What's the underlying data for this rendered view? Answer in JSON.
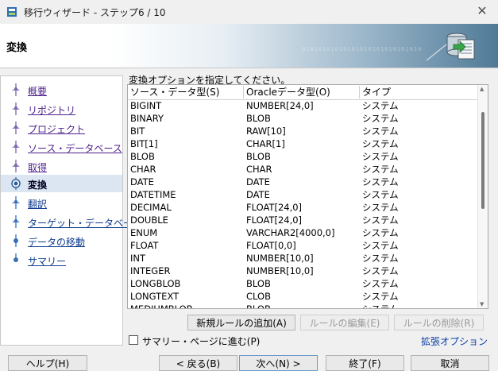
{
  "window": {
    "title": "移行ウィザード - ステップ6 / 10",
    "close": "✕"
  },
  "banner": {
    "title": "変換",
    "binary_text": "01010101010101010101010101010"
  },
  "nav": {
    "items": [
      {
        "label": "概要",
        "state": "done"
      },
      {
        "label": "リポジトリ",
        "state": "done"
      },
      {
        "label": "プロジェクト",
        "state": "done"
      },
      {
        "label": "ソース・データベース",
        "state": "done"
      },
      {
        "label": "取得",
        "state": "done"
      },
      {
        "label": "変換",
        "state": "active"
      },
      {
        "label": "翻訳",
        "state": "future"
      },
      {
        "label": "ターゲット・データベース",
        "state": "future"
      },
      {
        "label": "データの移動",
        "state": "future"
      },
      {
        "label": "サマリー",
        "state": "future"
      }
    ]
  },
  "main": {
    "instruction": "変換オプションを指定してください。",
    "table": {
      "headers": [
        "ソース・データ型(S)",
        "Oracleデータ型(O)",
        "タイプ"
      ],
      "rows": [
        [
          "BIGINT",
          "NUMBER[24,0]",
          "システム"
        ],
        [
          "BINARY",
          "BLOB",
          "システム"
        ],
        [
          "BIT",
          "RAW[10]",
          "システム"
        ],
        [
          "BIT[1]",
          "CHAR[1]",
          "システム"
        ],
        [
          "BLOB",
          "BLOB",
          "システム"
        ],
        [
          "CHAR",
          "CHAR",
          "システム"
        ],
        [
          "DATE",
          "DATE",
          "システム"
        ],
        [
          "DATETIME",
          "DATE",
          "システム"
        ],
        [
          "DECIMAL",
          "FLOAT[24,0]",
          "システム"
        ],
        [
          "DOUBLE",
          "FLOAT[24,0]",
          "システム"
        ],
        [
          "ENUM",
          "VARCHAR2[4000,0]",
          "システム"
        ],
        [
          "FLOAT",
          "FLOAT[0,0]",
          "システム"
        ],
        [
          "INT",
          "NUMBER[10,0]",
          "システム"
        ],
        [
          "INTEGER",
          "NUMBER[10,0]",
          "システム"
        ],
        [
          "LONGBLOB",
          "BLOB",
          "システム"
        ],
        [
          "LONGTEXT",
          "CLOB",
          "システム"
        ],
        [
          "MEDIUMBLOB",
          "BLOB",
          "システム"
        ]
      ]
    },
    "buttons": {
      "add_rule": "新規ルールの追加(A)",
      "edit_rule": "ルールの編集(E)",
      "delete_rule": "ルールの削除(R)"
    },
    "checkbox_label": "サマリー・ページに進む(P)",
    "checkbox_checked": false,
    "advanced_link": "拡張オプション"
  },
  "footer": {
    "help": "ヘルプ(H)",
    "back": "< 戻る(B)",
    "next": "次へ(N) >",
    "finish": "終了(F)",
    "cancel": "取消"
  }
}
